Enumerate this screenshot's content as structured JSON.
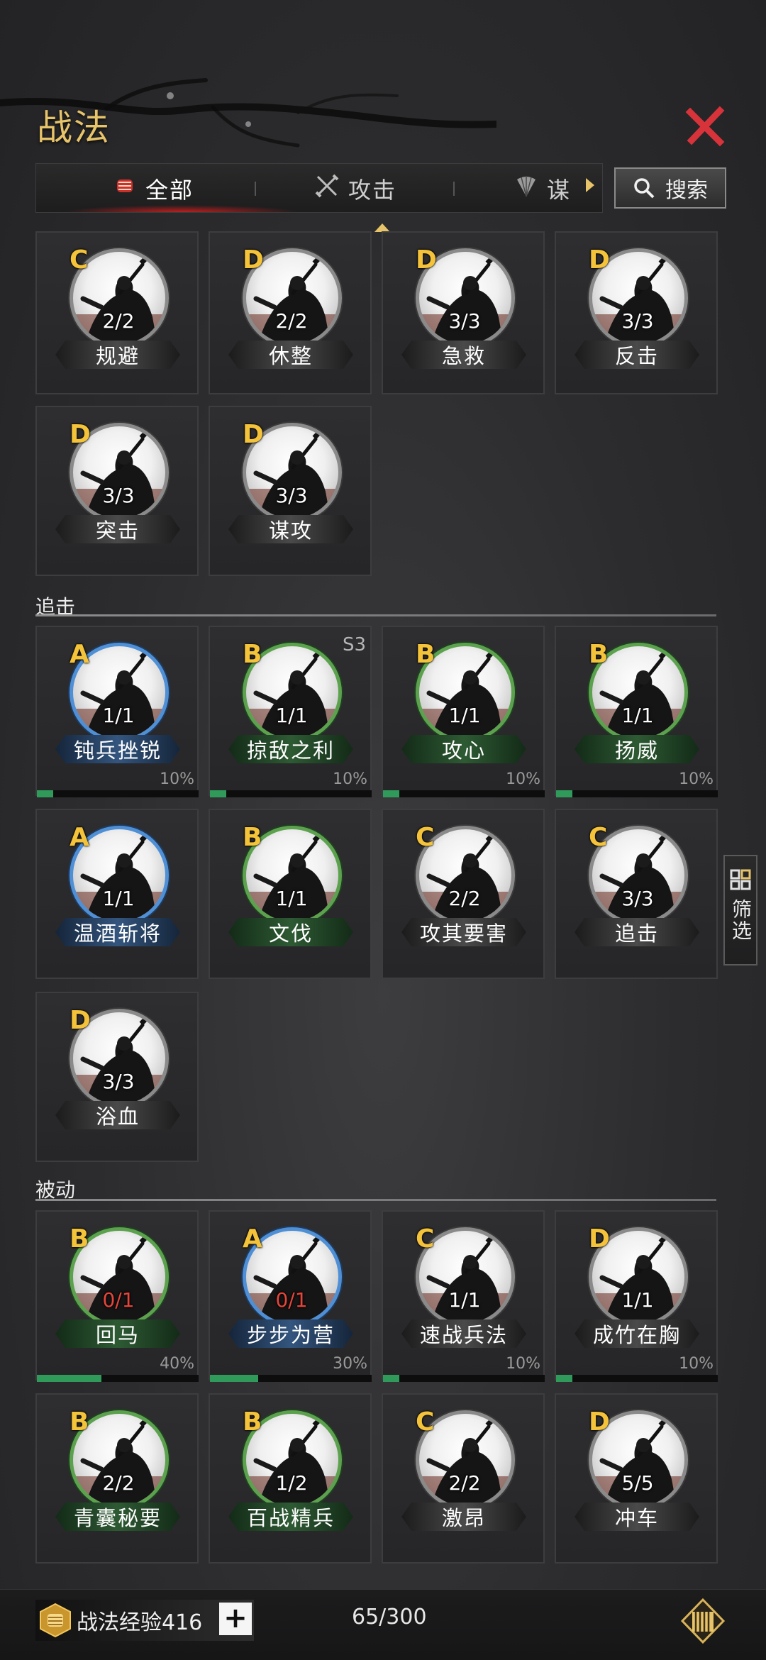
{
  "header": {
    "title": "战法"
  },
  "tabs": [
    {
      "label": "全部",
      "icon": "fist-icon",
      "active": true
    },
    {
      "label": "攻击",
      "icon": "crossed-swords-icon",
      "active": false
    },
    {
      "label": "谋",
      "icon": "fan-icon",
      "active": false
    }
  ],
  "search": {
    "label": "搜索"
  },
  "sections": {
    "pursuit": {
      "label": "追击"
    },
    "passive": {
      "label": "被动"
    }
  },
  "cards": [
    {
      "grade": "C",
      "level": "2/2",
      "name": "规避",
      "ring": "gray",
      "plate": "gray"
    },
    {
      "grade": "D",
      "level": "2/2",
      "name": "休整",
      "ring": "gray",
      "plate": "gray"
    },
    {
      "grade": "D",
      "level": "3/3",
      "name": "急救",
      "ring": "gray",
      "plate": "gray"
    },
    {
      "grade": "D",
      "level": "3/3",
      "name": "反击",
      "ring": "gray",
      "plate": "gray"
    },
    {
      "grade": "D",
      "level": "3/3",
      "name": "突击",
      "ring": "gray",
      "plate": "gray"
    },
    {
      "grade": "D",
      "level": "3/3",
      "name": "谋攻",
      "ring": "gray",
      "plate": "gray"
    },
    {
      "grade": "A",
      "level": "1/1",
      "name": "钝兵挫锐",
      "ring": "blue",
      "plate": "blue",
      "pct": "10%",
      "progress": 0.1
    },
    {
      "grade": "B",
      "level": "1/1",
      "name": "掠敌之利",
      "ring": "green",
      "plate": "green",
      "pct": "10%",
      "progress": 0.1,
      "season": "S3"
    },
    {
      "grade": "B",
      "level": "1/1",
      "name": "攻心",
      "ring": "green",
      "plate": "green",
      "pct": "10%",
      "progress": 0.1
    },
    {
      "grade": "B",
      "level": "1/1",
      "name": "扬威",
      "ring": "green",
      "plate": "green",
      "pct": "10%",
      "progress": 0.1
    },
    {
      "grade": "A",
      "level": "1/1",
      "name": "温酒斩将",
      "ring": "blue",
      "plate": "blue"
    },
    {
      "grade": "B",
      "level": "1/1",
      "name": "文伐",
      "ring": "green",
      "plate": "green"
    },
    {
      "grade": "C",
      "level": "2/2",
      "name": "攻其要害",
      "ring": "gray",
      "plate": "gray"
    },
    {
      "grade": "C",
      "level": "3/3",
      "name": "追击",
      "ring": "gray",
      "plate": "gray"
    },
    {
      "grade": "D",
      "level": "3/3",
      "name": "浴血",
      "ring": "gray",
      "plate": "gray"
    },
    {
      "grade": "B",
      "level": "0/1",
      "name": "回马",
      "ring": "green",
      "plate": "green",
      "pct": "40%",
      "progress": 0.4,
      "levelColor": "red"
    },
    {
      "grade": "A",
      "level": "0/1",
      "name": "步步为营",
      "ring": "blue",
      "plate": "blue",
      "pct": "30%",
      "progress": 0.3,
      "levelColor": "red"
    },
    {
      "grade": "C",
      "level": "1/1",
      "name": "速战兵法",
      "ring": "gray",
      "plate": "gray",
      "pct": "10%",
      "progress": 0.1
    },
    {
      "grade": "D",
      "level": "1/1",
      "name": "成竹在胸",
      "ring": "gray",
      "plate": "gray",
      "pct": "10%",
      "progress": 0.1
    },
    {
      "grade": "B",
      "level": "2/2",
      "name": "青囊秘要",
      "ring": "green",
      "plate": "green"
    },
    {
      "grade": "B",
      "level": "1/2",
      "name": "百战精兵",
      "ring": "green",
      "plate": "green"
    },
    {
      "grade": "C",
      "level": "2/2",
      "name": "激昂",
      "ring": "gray",
      "plate": "gray"
    },
    {
      "grade": "D",
      "level": "5/5",
      "name": "冲车",
      "ring": "gray",
      "plate": "gray"
    }
  ],
  "side_filter": {
    "label": "筛选",
    "icon": "grid-icon"
  },
  "footer": {
    "exp_label": "战法经验416",
    "plus": "+",
    "count": "65/300"
  },
  "colors": {
    "accent": "#e7c46a",
    "grade": "#f4c33a",
    "close": "#d8333a",
    "progress": "#2f9a5a"
  }
}
